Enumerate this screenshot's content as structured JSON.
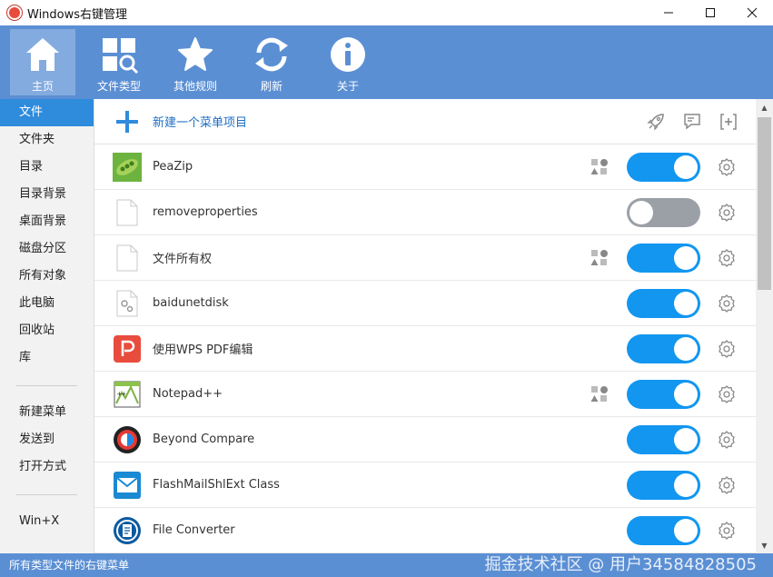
{
  "window": {
    "title": "Windows右键管理"
  },
  "toolbar": {
    "items": [
      {
        "label": "主页",
        "icon": "home-icon",
        "active": true
      },
      {
        "label": "文件类型",
        "icon": "apps-search-icon"
      },
      {
        "label": "其他规则",
        "icon": "star-icon"
      },
      {
        "label": "刷新",
        "icon": "refresh-icon"
      },
      {
        "label": "关于",
        "icon": "info-icon"
      }
    ]
  },
  "sidebar": {
    "items": [
      "文件",
      "文件夹",
      "目录",
      "目录背景",
      "桌面背景",
      "磁盘分区",
      "所有对象",
      "此电脑",
      "回收站",
      "库"
    ],
    "items2": [
      "新建菜单",
      "发送到",
      "打开方式"
    ],
    "items3": [
      "Win+X"
    ],
    "active": "文件"
  },
  "main": {
    "new_label": "新建一个菜单项目",
    "rows": [
      {
        "label": "PeaZip",
        "icon": "peazip-icon",
        "enabled": true,
        "has_shapes": true
      },
      {
        "label": "removeproperties",
        "icon": "blank-file-icon",
        "enabled": false,
        "has_shapes": false
      },
      {
        "label": "文件所有权",
        "icon": "blank-file-icon",
        "enabled": true,
        "has_shapes": true
      },
      {
        "label": "baidunetdisk",
        "icon": "gear-file-icon",
        "enabled": true,
        "has_shapes": false
      },
      {
        "label": "使用WPS PDF编辑",
        "icon": "wps-pdf-icon",
        "enabled": true,
        "has_shapes": false
      },
      {
        "label": "Notepad++",
        "icon": "notepadpp-icon",
        "enabled": true,
        "has_shapes": true
      },
      {
        "label": "Beyond Compare",
        "icon": "beyond-compare-icon",
        "enabled": true,
        "has_shapes": false
      },
      {
        "label": "FlashMailShlExt Class",
        "icon": "flashmail-icon",
        "enabled": true,
        "has_shapes": false
      },
      {
        "label": "File Converter",
        "icon": "file-converter-icon",
        "enabled": true,
        "has_shapes": false
      }
    ]
  },
  "status": {
    "text": "所有类型文件的右键菜单",
    "watermark": "掘金技术社区 @ 用户34584828505"
  },
  "colors": {
    "accent": "#5b8fd4",
    "toggle_on": "#1296f0",
    "toggle_off": "#9aa0a6",
    "sidebar_active": "#2f8bdc"
  }
}
